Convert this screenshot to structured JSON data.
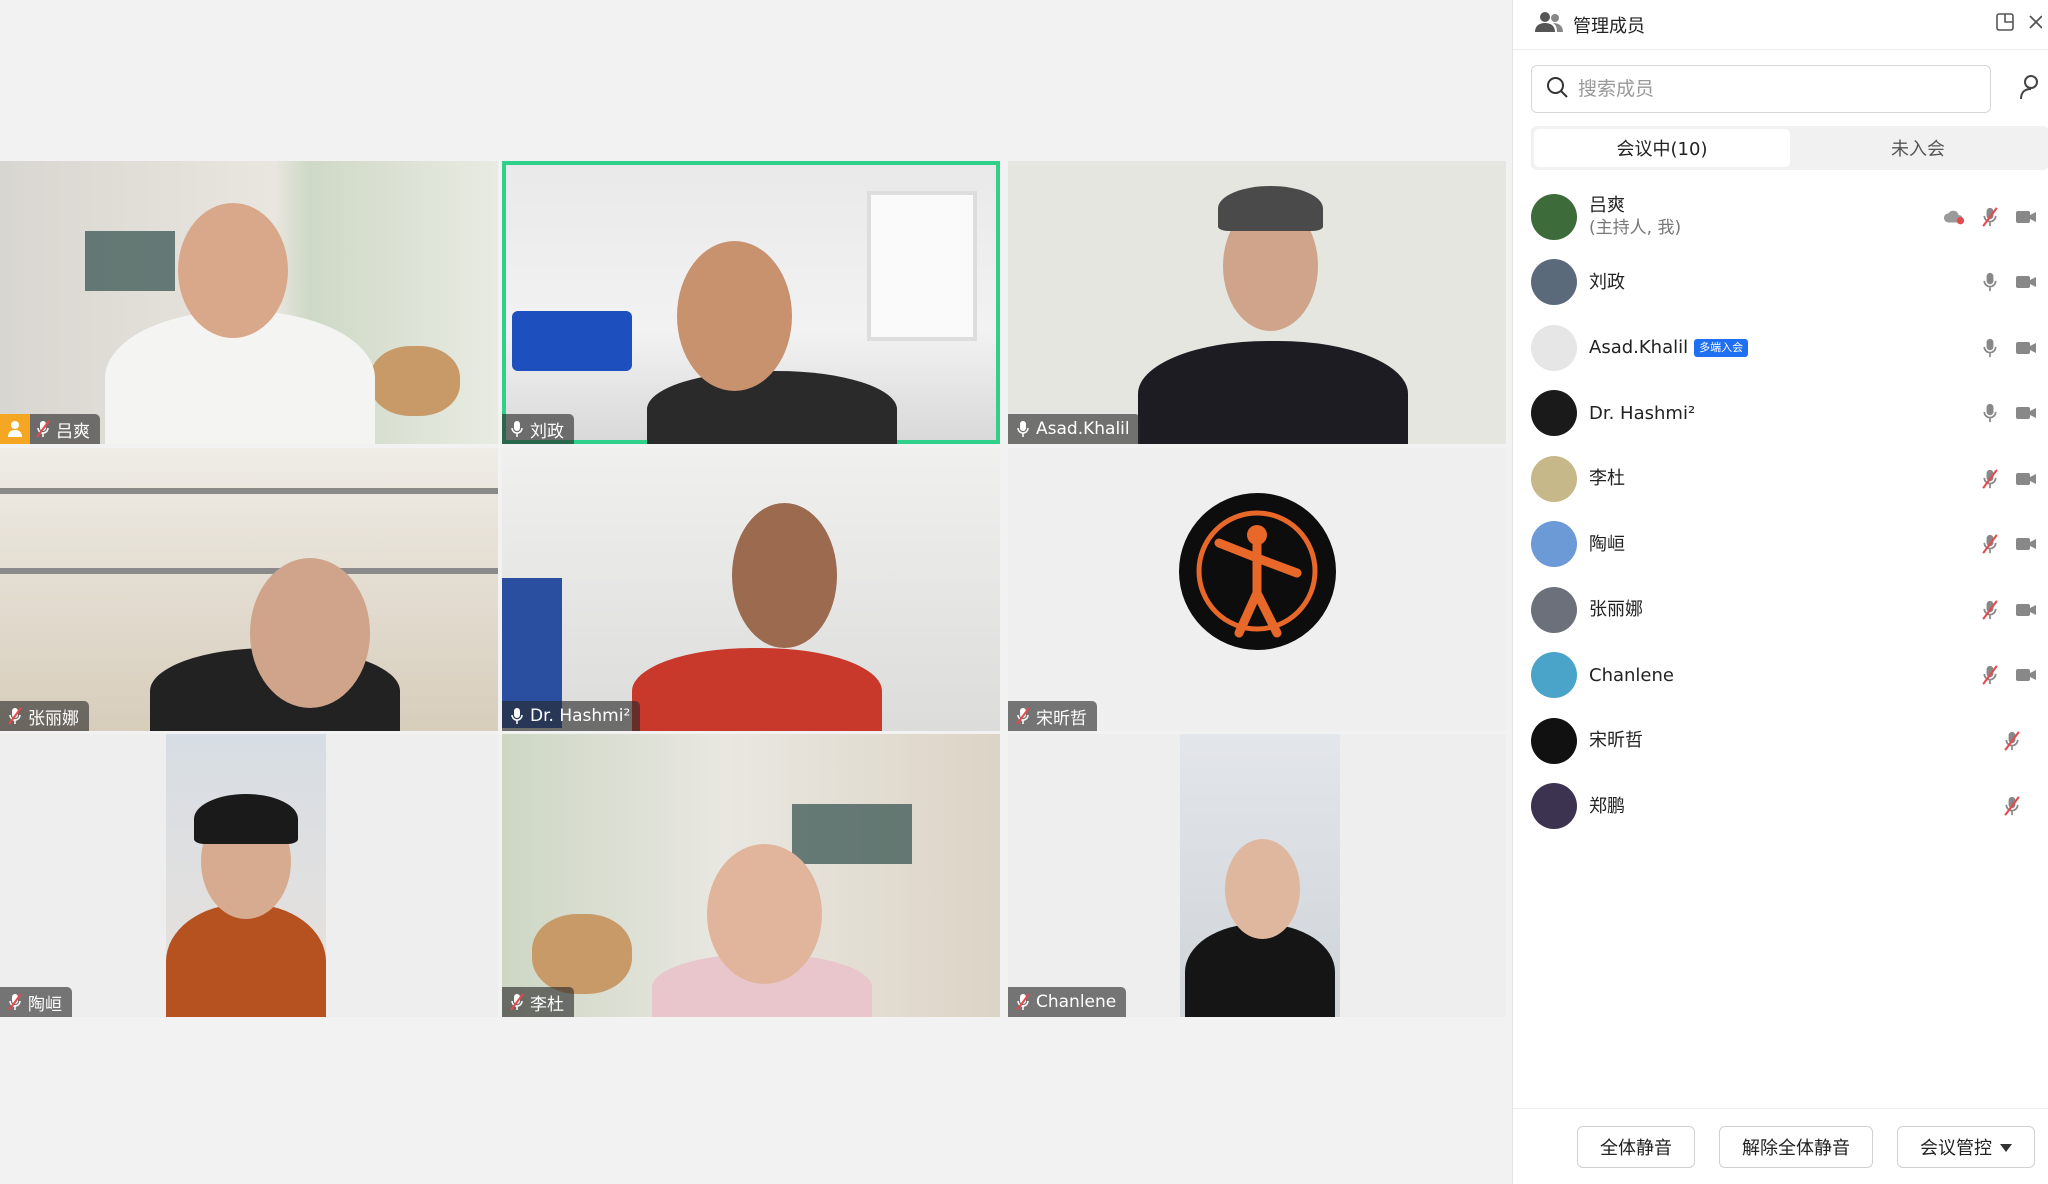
{
  "panel": {
    "title": "管理成员",
    "search_placeholder": "搜索成员",
    "tabs": [
      {
        "label": "会议中(10)"
      },
      {
        "label": "未入会"
      }
    ],
    "members": [
      {
        "name": "吕爽",
        "sub": "(主持人, 我)",
        "mic": "muted",
        "video": true,
        "cloud": true
      },
      {
        "name": "刘政",
        "mic": "on",
        "video": true
      },
      {
        "name": "Asad.Khalil",
        "badge": "多端入会",
        "mic": "on",
        "video": true
      },
      {
        "name": "Dr. Hashmi²",
        "mic": "on",
        "video": true
      },
      {
        "name": "李杜",
        "mic": "muted",
        "video": true
      },
      {
        "name": "陶峘",
        "mic": "muted",
        "video": true
      },
      {
        "name": "张丽娜",
        "mic": "muted",
        "video": true
      },
      {
        "name": "Chanlene",
        "mic": "muted",
        "video": true
      },
      {
        "name": "宋昕哲",
        "mic": "muted",
        "video": false
      },
      {
        "name": "郑鹏",
        "mic": "muted",
        "video": false
      }
    ],
    "footer": {
      "mute_all": "全体静音",
      "unmute_all": "解除全体静音",
      "control": "会议管控"
    }
  },
  "tiles": [
    {
      "name": "吕爽",
      "mic": "muted",
      "host": true
    },
    {
      "name": "刘政",
      "mic": "on",
      "active": true
    },
    {
      "name": "Asad.Khalil",
      "mic": "on"
    },
    {
      "name": "张丽娜",
      "mic": "muted"
    },
    {
      "name": "Dr. Hashmi²",
      "mic": "on"
    },
    {
      "name": "宋昕哲",
      "mic": "muted"
    },
    {
      "name": "陶峘",
      "mic": "muted"
    },
    {
      "name": "李杜",
      "mic": "muted"
    },
    {
      "name": "Chanlene",
      "mic": "muted"
    }
  ],
  "colors": {
    "active": "#2fd08a",
    "host_badge": "#f5a623",
    "badge_blue": "#1f6ff2",
    "mute_red": "#e5484d"
  }
}
